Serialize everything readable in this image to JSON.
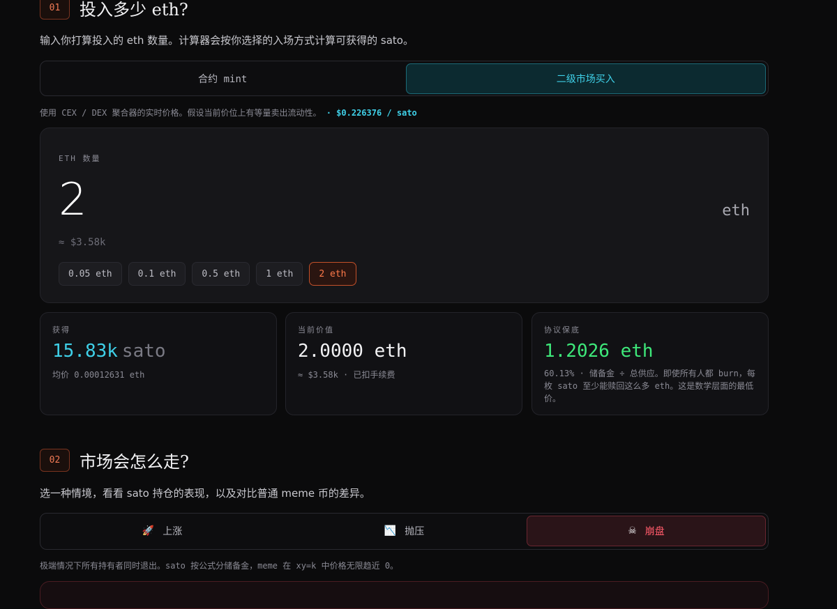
{
  "section1": {
    "number": "01",
    "title": "投入多少 eth?",
    "description": "输入你打算投入的 eth 数量。计算器会按你选择的入场方式计算可获得的 sato。",
    "modes": [
      "合约 mint",
      "二级市场买入"
    ],
    "active_mode_index": 1,
    "price_note": "使用 CEX / DEX 聚合器的实时价格。假设当前价位上有等量卖出流动性。",
    "price_value": "· $0.226376 / sato"
  },
  "eth_input": {
    "label": "ETH 数量",
    "value": "2",
    "unit": "eth",
    "usd_approx": "≈ $3.58k",
    "presets": [
      "0.05 eth",
      "0.1 eth",
      "0.5 eth",
      "1 eth",
      "2 eth"
    ],
    "selected_preset_index": 4
  },
  "stats": {
    "receive": {
      "label": "获得",
      "value": "15.83k",
      "unit": "sato",
      "sub": "均价 0.00012631 eth"
    },
    "current_value": {
      "label": "当前价值",
      "value": "2.0000 eth",
      "sub": "≈ $3.58k · 已扣手续费"
    },
    "protocol_floor": {
      "label": "协议保底",
      "value": "1.2026 eth",
      "sub": "60.13% · 储备金 ÷ 总供应。即使所有人都 burn，每枚 sato 至少能赎回这么多 eth。这是数学层面的最低价。"
    }
  },
  "section2": {
    "number": "02",
    "title": "市场会怎么走?",
    "description": "选一种情境，看看 sato 持仓的表现，以及对比普通 meme 币的差异。",
    "scenarios": [
      {
        "icon": "rocket-icon",
        "glyph": "🚀",
        "label": "上涨"
      },
      {
        "icon": "chart-down-icon",
        "glyph": "📉",
        "label": "抛压"
      },
      {
        "icon": "skull-icon",
        "glyph": "☠",
        "label": "崩盘"
      }
    ],
    "active_scenario_index": 2,
    "scenario_note": "极端情况下所有持有者同时退出。sato 按公式分储备金，meme 在 xy=k 中价格无限趋近 0。"
  },
  "colors": {
    "accent_cyan": "#3fd0e8",
    "accent_orange": "#ff7a4a",
    "accent_green": "#3ee87a",
    "accent_red": "#ff5a6a"
  }
}
